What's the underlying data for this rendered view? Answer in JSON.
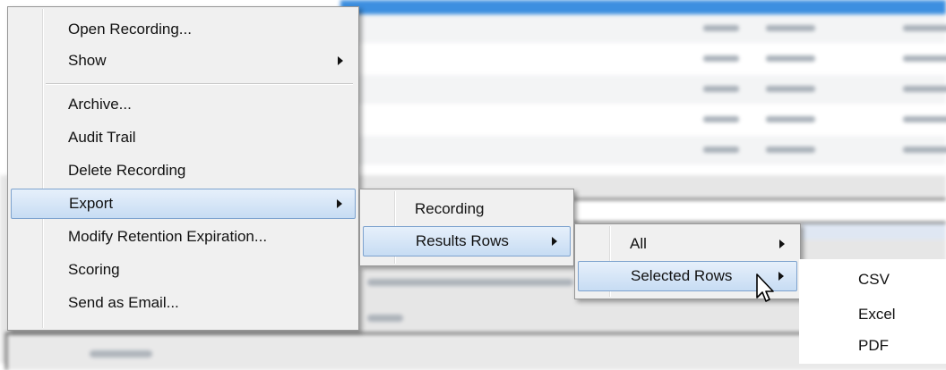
{
  "context_menu": {
    "items": [
      {
        "label": "Open Recording...",
        "submenu": false
      },
      {
        "label": "Show",
        "submenu": true
      },
      {
        "label": "Archive...",
        "submenu": false
      },
      {
        "label": "Audit Trail",
        "submenu": false
      },
      {
        "label": "Delete Recording",
        "submenu": false
      },
      {
        "label": "Export",
        "submenu": true,
        "highlighted": true
      },
      {
        "label": "Modify Retention Expiration...",
        "submenu": false
      },
      {
        "label": "Scoring",
        "submenu": false
      },
      {
        "label": "Send as Email...",
        "submenu": false
      }
    ]
  },
  "export_submenu": {
    "items": [
      {
        "label": "Recording",
        "submenu": false
      },
      {
        "label": "Results Rows",
        "submenu": true,
        "highlighted": true
      }
    ]
  },
  "results_rows_submenu": {
    "items": [
      {
        "label": "All",
        "submenu": true
      },
      {
        "label": "Selected Rows",
        "submenu": true,
        "highlighted": true
      }
    ]
  },
  "selected_rows_submenu": {
    "items": [
      {
        "label": "CSV"
      },
      {
        "label": "Excel"
      },
      {
        "label": "PDF"
      }
    ]
  },
  "colors": {
    "highlight_top": "#e6f0fb",
    "highlight_bottom": "#c7dcf3",
    "highlight_border": "#7da2ce",
    "menu_background": "#f0f0f0",
    "grid_header": "#3d8fe0"
  }
}
